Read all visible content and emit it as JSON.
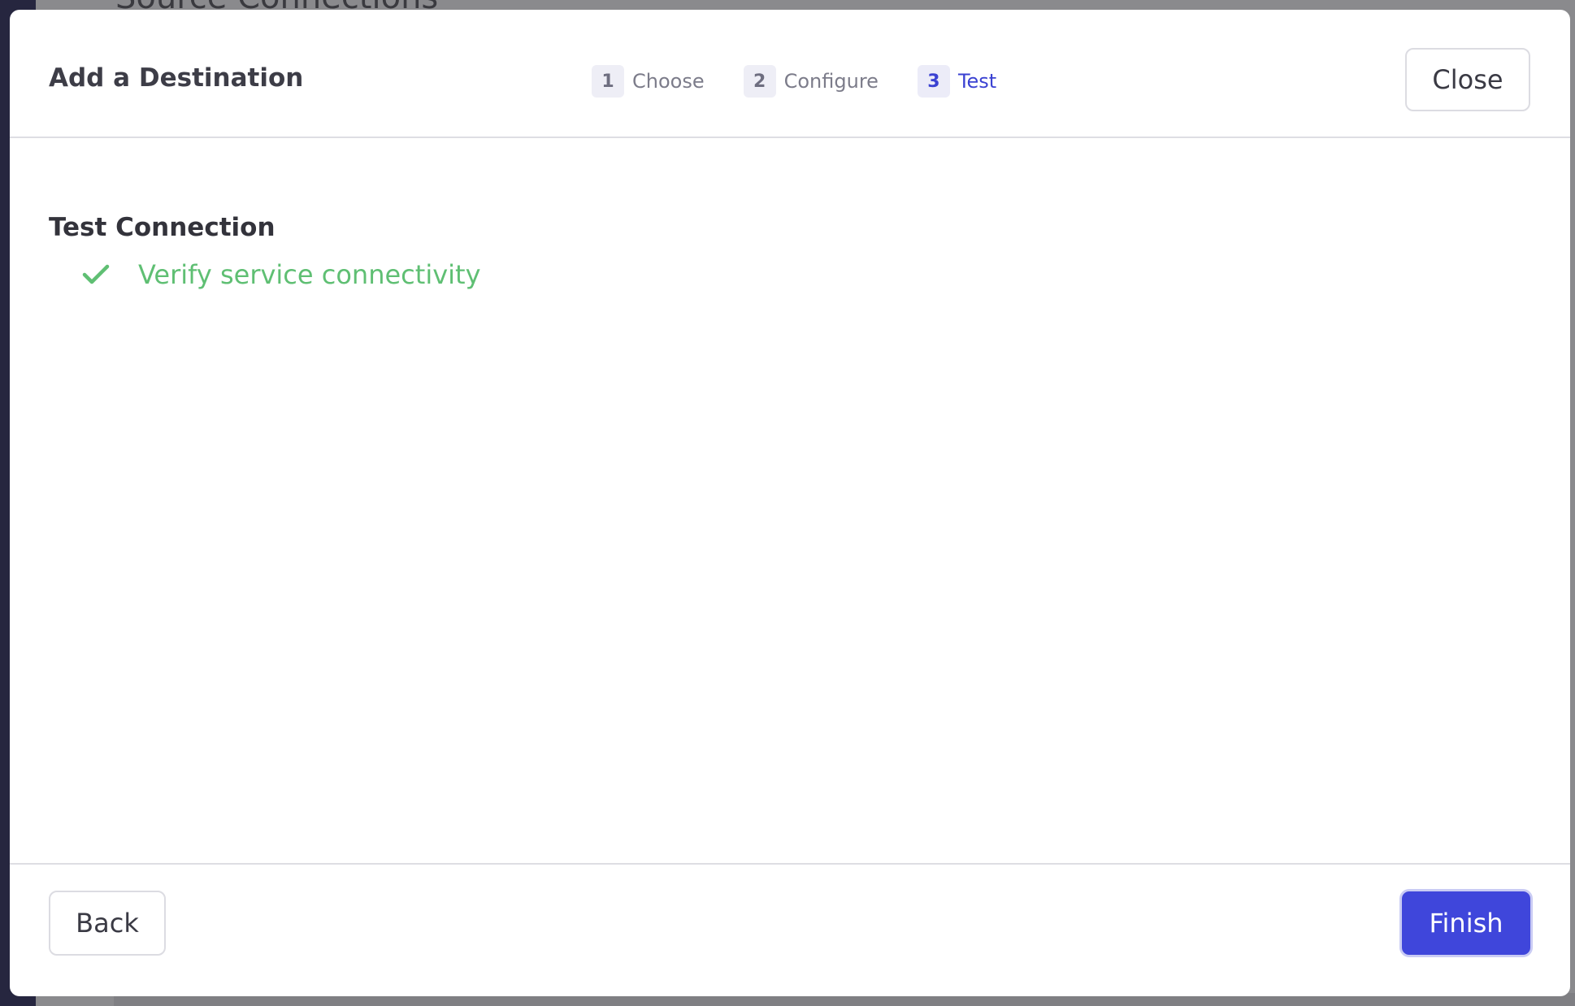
{
  "background": {
    "title": "Source Connections"
  },
  "modal": {
    "title": "Add a Destination",
    "close_label": "Close",
    "steps": [
      {
        "number": "1",
        "label": "Choose",
        "active": false
      },
      {
        "number": "2",
        "label": "Configure",
        "active": false
      },
      {
        "number": "3",
        "label": "Test",
        "active": true
      }
    ],
    "body": {
      "section_title": "Test Connection",
      "checks": [
        {
          "label": "Verify service connectivity",
          "status": "success",
          "icon": "check-icon"
        }
      ]
    },
    "footer": {
      "back_label": "Back",
      "finish_label": "Finish"
    }
  },
  "colors": {
    "accent": "#3f46db",
    "success": "#5fbf73",
    "step_active": "#3b42d2"
  }
}
